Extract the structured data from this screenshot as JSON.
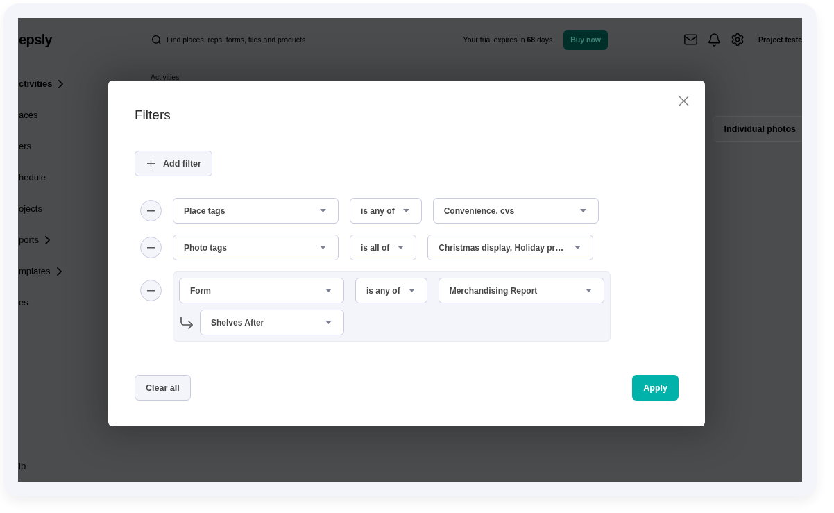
{
  "app": {
    "logo": "epsly",
    "search": {
      "placeholder": "Find places, reps, forms, files and products"
    },
    "trial_notice": "Your trial expires in **68** days",
    "buy_button": "Buy now",
    "user": "Project teste",
    "breadcrumb": "Activities",
    "view_button": "Individual photos",
    "sidebar": {
      "items": [
        {
          "label": "ctivities",
          "selected": true,
          "expandable": true
        },
        {
          "label": "aces",
          "selected": false,
          "expandable": false
        },
        {
          "label": "ers",
          "selected": false,
          "expandable": false
        },
        {
          "label": "hedule",
          "selected": false,
          "expandable": false
        },
        {
          "label": "ojects",
          "selected": false,
          "expandable": false
        },
        {
          "label": "ports",
          "selected": false,
          "expandable": true
        },
        {
          "label": "mplates",
          "selected": false,
          "expandable": true
        },
        {
          "label": "es",
          "selected": false,
          "expandable": false
        }
      ],
      "bottom_items": [
        {
          "label": "lp",
          "selected": false,
          "expandable": false
        }
      ]
    }
  },
  "modal": {
    "title": "Filters",
    "add_filter_button": "Add filter",
    "filters": [
      {
        "kind": "simple",
        "field": "Place tags",
        "operator": "is any of",
        "value": "Convenience, cvs"
      },
      {
        "kind": "simple",
        "field": "Photo tags",
        "operator": "is all of",
        "value": "Christmas display, Holiday pr…"
      },
      {
        "kind": "nested",
        "field": "Form",
        "operator": "is any of",
        "value": "Merchandising Report",
        "subfield": "Shelves After"
      }
    ],
    "clear_button": "Clear all",
    "apply_button": "Apply"
  }
}
